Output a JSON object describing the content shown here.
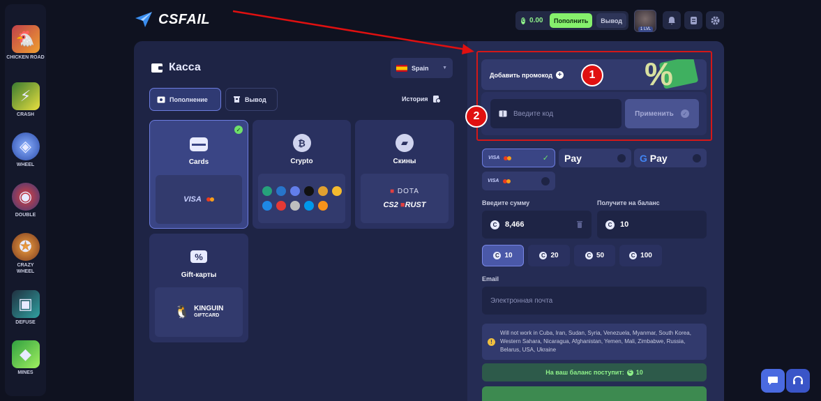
{
  "sidebar": {
    "items": [
      {
        "label": "CHICKEN ROAD",
        "icon": "chicken-icon"
      },
      {
        "label": "CRASH",
        "icon": "lightning-icon"
      },
      {
        "label": "WHEEL",
        "icon": "wheel-icon"
      },
      {
        "label": "DOUBLE",
        "icon": "double-icon"
      },
      {
        "label": "CRAZY WHEEL",
        "icon": "crazy-wheel-icon"
      },
      {
        "label": "DEFUSE",
        "icon": "bomb-icon"
      },
      {
        "label": "MINES",
        "icon": "gem-icon"
      }
    ]
  },
  "header": {
    "logo": "CSFAIL",
    "balance": "0.00",
    "topup_label": "Пополнить",
    "withdraw_label": "Вывод",
    "level": "1 LVL"
  },
  "cashier": {
    "title": "Касса",
    "country": "Spain",
    "tabs": [
      {
        "label": "Пополнение",
        "active": true
      },
      {
        "label": "Вывод",
        "active": false
      }
    ],
    "history_label": "История",
    "methods": [
      {
        "name": "Cards",
        "selected": true,
        "sub": "VISA"
      },
      {
        "name": "Crypto",
        "selected": false
      },
      {
        "name": "Скины",
        "selected": false,
        "sub1": "DOTA",
        "sub2": "CS2",
        "sub3": "RUST"
      },
      {
        "name": "Gift-карты",
        "selected": false,
        "sub1": "KINGUIN",
        "sub2": "GIFTCARD"
      }
    ]
  },
  "promo": {
    "add_label": "Добавить промокод",
    "code_placeholder": "Введите код",
    "apply_label": "Применить",
    "percent": "%"
  },
  "annotations": {
    "badge1": "1",
    "badge2": "2"
  },
  "payment_options": [
    {
      "name": "VISA",
      "selected": true
    },
    {
      "name": "Pay",
      "brand": "Apple",
      "selected": false
    },
    {
      "name": "Pay",
      "brand": "Google",
      "selected": false
    },
    {
      "name": "VISA",
      "selected": false
    }
  ],
  "amount": {
    "enter_label": "Введите сумму",
    "value": "8,466",
    "receive_label": "Получите на баланс",
    "receive_value": "10",
    "presets": [
      "10",
      "20",
      "50",
      "100"
    ]
  },
  "email": {
    "label": "Email",
    "placeholder": "Электронная почта"
  },
  "warning": {
    "text": "Will not work in Cuba, Iran, Sudan, Syria, Venezuela, Myanmar, South Korea, Western Sahara, Nicaragua, Afghanistan, Yemen, Mali, Zimbabwe, Russia, Belarus, USA, Ukraine"
  },
  "receive_bar": {
    "label": "На ваш баланс поступит:",
    "value": "10"
  },
  "colors": {
    "accent_green": "#86f06c",
    "highlight_red": "#d41818",
    "panel": "#1e2445"
  }
}
